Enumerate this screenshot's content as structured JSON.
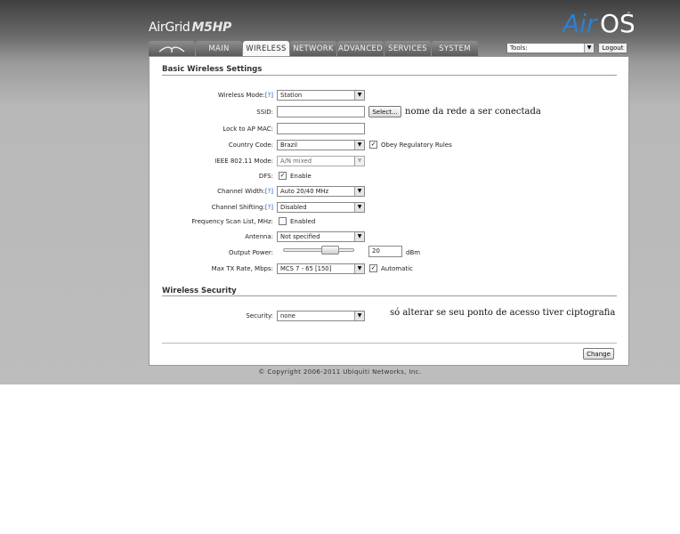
{
  "header": {
    "brand": "AirGrid",
    "model": "M5HP",
    "os_logo": "AirOS",
    "os_logo_mark": "TM"
  },
  "tabs": [
    {
      "label": "",
      "icon": "ubiquiti-logo-icon"
    },
    {
      "label": "MAIN"
    },
    {
      "label": "WIRELESS",
      "active": true
    },
    {
      "label": "NETWORK"
    },
    {
      "label": "ADVANCED"
    },
    {
      "label": "SERVICES"
    },
    {
      "label": "SYSTEM"
    }
  ],
  "tools": {
    "label": "Tools:",
    "logout": "Logout"
  },
  "basic": {
    "title": "Basic Wireless Settings",
    "wireless_mode": {
      "label": "Wireless Mode:",
      "help": "[?]",
      "value": "Station"
    },
    "ssid": {
      "label": "SSID:",
      "value": "",
      "select_button": "Select...",
      "note": "nome da rede a ser conectada"
    },
    "lock_ap_mac": {
      "label": "Lock to AP MAC:",
      "value": ""
    },
    "country_code": {
      "label": "Country Code:",
      "value": "Brazil",
      "obey_label": "Obey Regulatory Rules",
      "obey_checked": true
    },
    "ieee_mode": {
      "label": "IEEE 802.11 Mode:",
      "value": "A/N mixed"
    },
    "dfs": {
      "label": "DFS:",
      "enable_label": "Enable",
      "checked": true
    },
    "channel_width": {
      "label": "Channel Width:",
      "help": "[?]",
      "value": "Auto 20/40 MHz"
    },
    "channel_shifting": {
      "label": "Channel Shifting:",
      "help": "[?]",
      "value": "Disabled"
    },
    "freq_scan": {
      "label": "Frequency Scan List, MHz:",
      "enabled_label": "Enabled",
      "checked": false
    },
    "antenna": {
      "label": "Antenna:",
      "value": "Not specified"
    },
    "output_power": {
      "label": "Output Power:",
      "value": "20",
      "unit": "dBm",
      "slider_fraction": 0.72
    },
    "max_tx": {
      "label": "Max TX Rate, Mbps:",
      "value": "MCS 7 - 65 [150]",
      "auto_label": "Automatic",
      "auto_checked": true
    }
  },
  "security": {
    "title": "Wireless Security",
    "label": "Security:",
    "value": "none",
    "note": "só alterar se seu ponto de acesso tiver ciptografia"
  },
  "change_button": "Change",
  "copyright": "© Copyright 2006-2011 Ubiquiti Networks, Inc.",
  "colors": {
    "help_link": "#1a5bd0",
    "logo_blue": "#2c7fd6"
  }
}
